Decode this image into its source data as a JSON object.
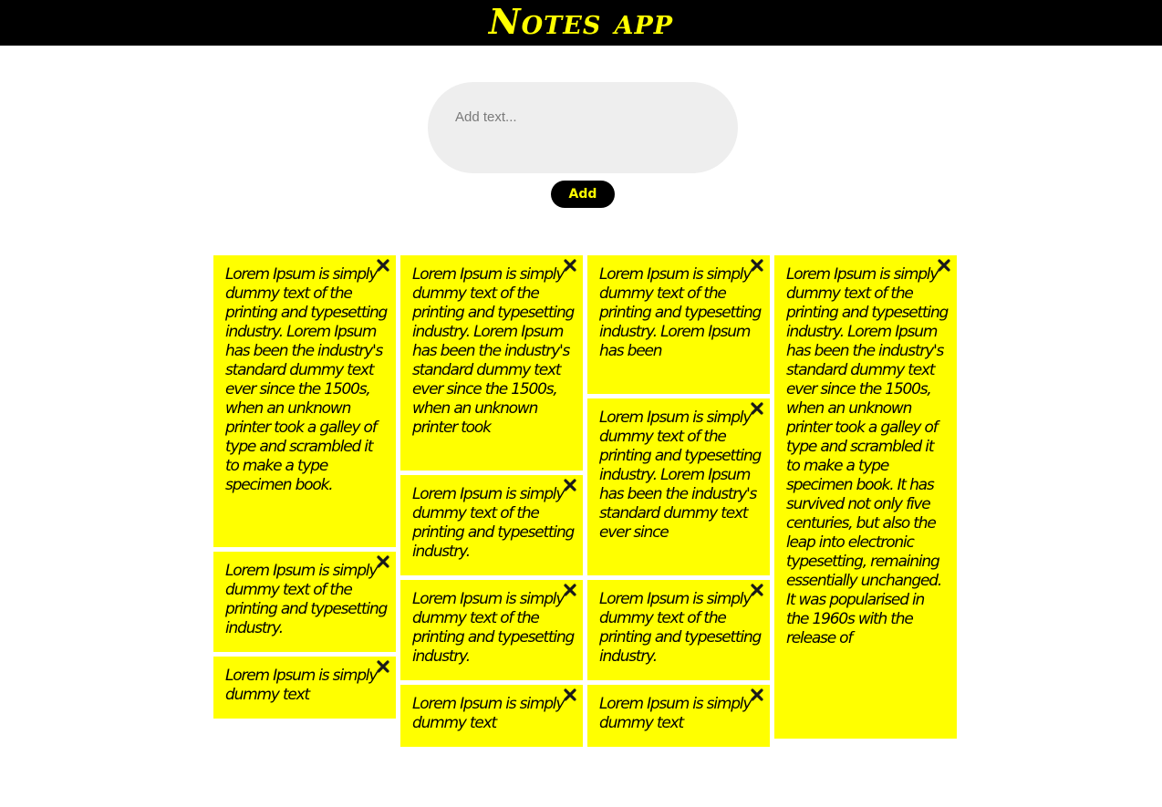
{
  "header": {
    "title": "Notes app"
  },
  "composer": {
    "placeholder": "Add text...",
    "value": "",
    "add_label": "Add"
  },
  "colors": {
    "header_bg": "#000000",
    "accent": "#ffff00",
    "note_bg": "#ffff00",
    "input_bg": "#eeeeee"
  },
  "icons": {
    "delete": "close-x-icon"
  },
  "notes": [
    {
      "text": "Lorem Ipsum is simply dummy text of the printing and typesetting industry. Lorem Ipsum has been the industry's standard dummy text ever since the 1500s, when an unknown printer took a galley of type and scrambled it to make a type specimen book."
    },
    {
      "text": "Lorem Ipsum is simply dummy text of the printing and typesetting industry."
    },
    {
      "text": "Lorem Ipsum is simply dummy text"
    },
    {
      "text": "Lorem Ipsum is simply dummy text of the printing and typesetting industry. Lorem Ipsum has been the industry's standard dummy text ever since the 1500s, when an unknown printer took"
    },
    {
      "text": "Lorem Ipsum is simply dummy text of the printing and typesetting industry."
    },
    {
      "text": "Lorem Ipsum is simply dummy text of the printing and typesetting industry."
    },
    {
      "text": "Lorem Ipsum is simply dummy text"
    },
    {
      "text": "Lorem Ipsum is simply dummy text of the printing and typesetting industry. Lorem Ipsum has been"
    },
    {
      "text": "Lorem Ipsum is simply dummy text of the printing and typesetting industry. Lorem Ipsum has been the industry's standard dummy text ever since"
    },
    {
      "text": "Lorem Ipsum is simply dummy text of the printing and typesetting industry."
    },
    {
      "text": "Lorem Ipsum is simply dummy text"
    },
    {
      "text": "Lorem Ipsum is simply dummy text of the printing and typesetting industry. Lorem Ipsum has been the industry's standard dummy text ever since the 1500s, when an unknown printer took a galley of type and scrambled it to make a type specimen book. It has survived not only five centuries, but also the leap into electronic typesetting, remaining essentially unchanged. It was popularised in the 1960s with the release of"
    }
  ]
}
